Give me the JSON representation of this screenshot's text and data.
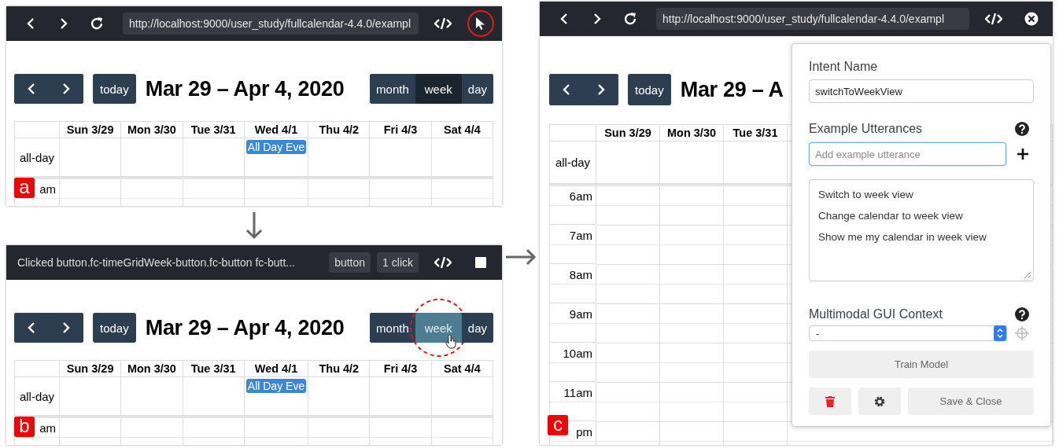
{
  "panels": [
    {
      "badge": "a",
      "toolbar": {
        "kind": "browser",
        "url": "http://localhost:9000/user_study/fullcalendar-4.4.0/exampl",
        "end_button": {
          "kind": "pick",
          "highlighted": true
        }
      },
      "calendar": {
        "title": "Mar 29 – Apr 4, 2020",
        "today": "today",
        "views": [
          {
            "label": "month",
            "selected": false,
            "hovered": false,
            "clicked": false
          },
          {
            "label": "week",
            "selected": true,
            "hovered": false,
            "clicked": false
          },
          {
            "label": "day",
            "selected": false,
            "hovered": false,
            "clicked": false
          }
        ],
        "columns": [
          {
            "label": "Sun 3/29"
          },
          {
            "label": "Mon 3/30"
          },
          {
            "label": "Tue 3/31"
          },
          {
            "label": "Wed 4/1",
            "event": "All Day Eve"
          },
          {
            "label": "Thu 4/2"
          },
          {
            "label": "Fri 4/3"
          },
          {
            "label": "Sat 4/4"
          }
        ],
        "all_day": "all-day",
        "times": [
          "am"
        ]
      }
    },
    {
      "badge": "b",
      "toolbar": {
        "kind": "recording",
        "message": "Clicked button.fc-timeGridWeek-button.fc-button fc-butt...",
        "chips": [
          "button",
          "1 click"
        ],
        "end_button": {
          "kind": "stop",
          "highlighted": false
        }
      },
      "calendar": {
        "title": "Mar 29 – Apr 4, 2020",
        "today": "today",
        "views": [
          {
            "label": "month",
            "selected": false,
            "hovered": false,
            "clicked": false
          },
          {
            "label": "week",
            "selected": true,
            "hovered": true,
            "clicked": true
          },
          {
            "label": "day",
            "selected": false,
            "hovered": false,
            "clicked": false
          }
        ],
        "columns": [
          {
            "label": "Sun 3/29"
          },
          {
            "label": "Mon 3/30"
          },
          {
            "label": "Tue 3/31"
          },
          {
            "label": "Wed 4/1",
            "event": "All Day Eve"
          },
          {
            "label": "Thu 4/2"
          },
          {
            "label": "Fri 4/3"
          },
          {
            "label": "Sat 4/4"
          }
        ],
        "all_day": "all-day",
        "times": [
          "am"
        ]
      }
    },
    {
      "badge": "c",
      "toolbar": {
        "kind": "browser",
        "url": "http://localhost:9000/user_study/fullcalendar-4.4.0/exampl",
        "end_button": {
          "kind": "close",
          "highlighted": false
        }
      },
      "calendar": {
        "title": "Mar 29 – A",
        "today": "today",
        "columns": [
          {
            "label": "Sun 3/29"
          },
          {
            "label": "Mon 3/30"
          },
          {
            "label": "Tue 3/31"
          }
        ],
        "all_day": "all-day",
        "times": [
          "6am",
          "7am",
          "8am",
          "9am",
          "10am",
          "11am",
          "pm"
        ]
      },
      "intent_editor": {
        "intent_name_label": "Intent Name",
        "intent_name": "switchToWeekView",
        "utterances_label": "Example Utterances",
        "utterance_placeholder": "Add example utterance",
        "utterances": [
          "Switch to week view",
          "Change calendar to week view",
          "Show me my calendar in week view"
        ],
        "context_label": "Multimodal GUI Context",
        "context_value": "-",
        "train_button": "Train Model",
        "save_button": "Save & Close"
      }
    }
  ]
}
